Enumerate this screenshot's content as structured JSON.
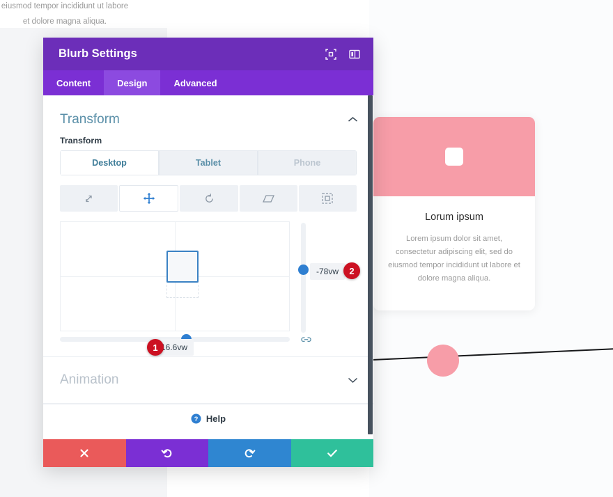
{
  "background": {
    "top_text_lines": [
      "eiusmod tempor incididunt ut labore",
      "et dolore magna aliqua."
    ],
    "blurb_card": {
      "title": "Lorum ipsum",
      "body": "Lorem ipsum dolor sit amet, consectetur adipiscing elit, sed do eiusmod tempor incididunt ut labore et dolore magna aliqua.",
      "image_color": "#f79da8",
      "icon_name": "rounded-square-icon"
    },
    "decor": {
      "circle_color": "#f79da8",
      "line_color": "#17181a"
    }
  },
  "modal": {
    "title": "Blurb Settings",
    "header_color": "#6c2eb9",
    "header_icons": [
      {
        "name": "focus-frame-icon"
      },
      {
        "name": "panel-layout-icon"
      }
    ],
    "tabs": [
      {
        "label": "Content",
        "active": false
      },
      {
        "label": "Design",
        "active": true
      },
      {
        "label": "Advanced",
        "active": false
      }
    ],
    "transform_section": {
      "title": "Transform",
      "collapse_state": "expanded",
      "chevron": "⌃",
      "field_label": "Transform",
      "devices": [
        {
          "label": "Desktop",
          "state": "active"
        },
        {
          "label": "Tablet",
          "state": "normal"
        },
        {
          "label": "Phone",
          "state": "disabled"
        }
      ],
      "modes": [
        {
          "name": "scale-icon",
          "active": false
        },
        {
          "name": "move-icon",
          "active": true
        },
        {
          "name": "rotate-icon",
          "active": false
        },
        {
          "name": "skew-icon",
          "active": false
        },
        {
          "name": "origin-icon",
          "active": false
        }
      ],
      "link_icon": "link-chain-icon",
      "values": {
        "horizontal": "16.6vw",
        "vertical": "-78vw"
      },
      "badges": {
        "horizontal": "1",
        "vertical": "2"
      }
    },
    "animation_section": {
      "title": "Animation",
      "collapse_state": "collapsed",
      "chevron": "⌄"
    },
    "help": {
      "label": "Help",
      "icon": "help-question-icon"
    },
    "footer_buttons": [
      {
        "name": "cancel-button",
        "glyph": "✖",
        "color": "#ea5a5a"
      },
      {
        "name": "undo-button",
        "glyph": "↺",
        "color": "#7b2fd4"
      },
      {
        "name": "redo-button",
        "glyph": "↻",
        "color": "#2f86d1"
      },
      {
        "name": "save-button",
        "glyph": "✔",
        "color": "#2fc09b"
      }
    ]
  }
}
